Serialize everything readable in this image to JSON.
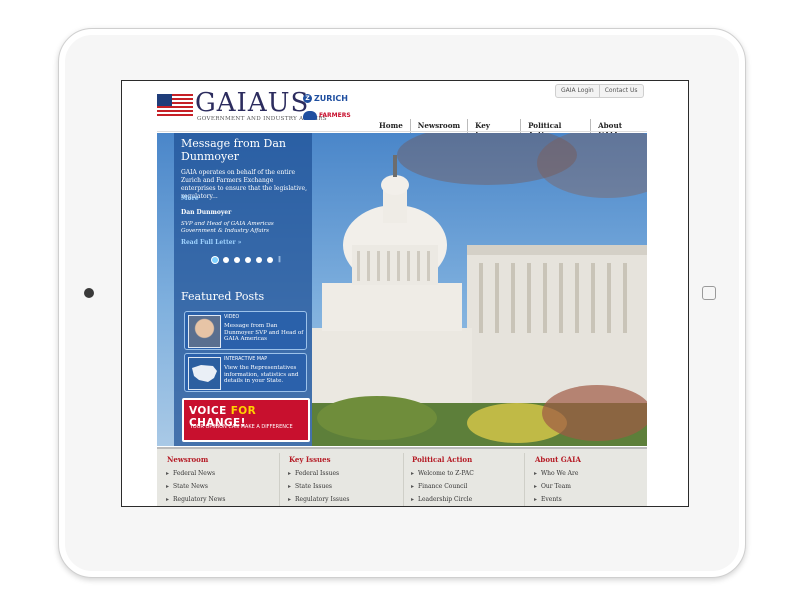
{
  "header": {
    "logo_text": "GAIAUS",
    "logo_subtitle": "GOVERNMENT AND INDUSTRY AFFAIRS",
    "partner_zurich": "ZURICH",
    "partner_farmers": "FARMERS",
    "top_links": [
      "GAIA Login",
      "Contact Us"
    ],
    "nav": [
      "Home",
      "Newsroom",
      "Key Issues",
      "Political Action",
      "About GAIA"
    ]
  },
  "hero": {
    "message_title": "Message from Dan Dunmoyer",
    "message_body": "GAIA operates on behalf of the entire Zurich and Farmers Exchange enterprises to ensure that the legislative, regulatory...",
    "more_link": "More",
    "author_name": "Dan Dunmoyer",
    "author_title": "SVP and Head of GAIA Americas Government & Industry Affairs",
    "read_full_link": "Read Full Letter",
    "slider_dots": 6,
    "active_dot": 0
  },
  "featured": {
    "heading": "Featured Posts",
    "posts": [
      {
        "label": "VIDEO",
        "text": "Message from Dan Dunmoyer SVP and Head of GAIA Americas"
      },
      {
        "label": "INTERACTIVE MAP",
        "text": "View the Representatives information, statistics and details in your State."
      }
    ],
    "banner_main_a": "VOICE ",
    "banner_main_b": "FOR",
    "banner_main_c": " CHANGE!",
    "banner_sub": "YOUR OPINION CAN MAKE A DIFFERENCE"
  },
  "footer": {
    "columns": [
      {
        "title": "Newsroom",
        "items": [
          "Federal News",
          "State News",
          "Regulatory News"
        ]
      },
      {
        "title": "Key Issues",
        "items": [
          "Federal Issues",
          "State Issues",
          "Regulatory Issues"
        ]
      },
      {
        "title": "Political Action",
        "items": [
          "Welcome to Z-PAC",
          "Finance Council",
          "Leadership Circle"
        ]
      },
      {
        "title": "About GAIA",
        "items": [
          "Who We Are",
          "Our Team",
          "Events"
        ]
      }
    ]
  },
  "colors": {
    "brand_navy": "#2c2c5e",
    "accent_red": "#b51b25",
    "panel_blue": "#1e5096",
    "link_blue": "#9fd3ff"
  }
}
